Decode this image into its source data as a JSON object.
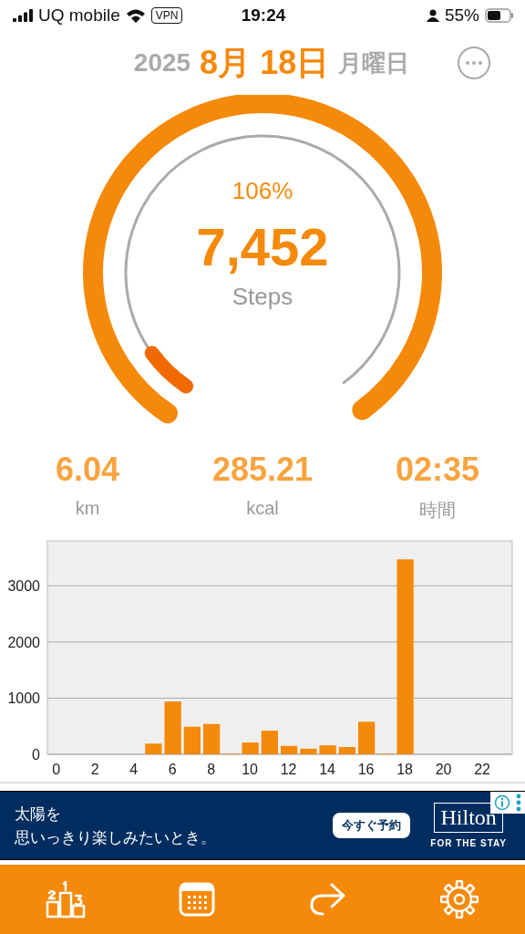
{
  "status_bar": {
    "carrier": "UQ mobile",
    "vpn": "VPN",
    "time": "19:24",
    "battery": "55%"
  },
  "date": {
    "year": "2025",
    "day": "8月 18日",
    "weekday": "月曜日"
  },
  "gauge": {
    "percent": "106%",
    "steps": "7,452",
    "unit": "Steps"
  },
  "stats": [
    {
      "value": "6.04",
      "label": "km"
    },
    {
      "value": "285.21",
      "label": "kcal"
    },
    {
      "value": "02:35",
      "label": "時間"
    }
  ],
  "chart_data": {
    "type": "bar",
    "x": [
      0,
      1,
      2,
      3,
      4,
      5,
      6,
      7,
      8,
      9,
      10,
      11,
      12,
      13,
      14,
      15,
      16,
      17,
      18,
      19,
      20,
      21,
      22,
      23
    ],
    "grid": true,
    "xlim": [
      -0.5,
      23.5
    ],
    "series": [
      {
        "color": "#f5890a",
        "values": [
          0,
          0,
          0,
          0,
          0,
          190,
          940,
          490,
          540,
          10,
          210,
          420,
          150,
          100,
          160,
          130,
          580,
          10,
          3470,
          0,
          0,
          0,
          0,
          0
        ]
      }
    ],
    "ylim": [
      0,
      3800
    ],
    "yticks": [
      0,
      1000,
      2000,
      3000
    ],
    "xticks": [
      0,
      2,
      4,
      6,
      8,
      10,
      12,
      14,
      16,
      18,
      20,
      22
    ]
  },
  "ad": {
    "headline_1": "太陽を",
    "headline_2": "思いっきり楽しみたいとき。",
    "cta": "今すぐ予約",
    "brand": "Hilton",
    "tagline": "FOR THE STAY"
  },
  "tab_bar": [
    {
      "kind": "ranking"
    },
    {
      "kind": "calendar"
    },
    {
      "kind": "share"
    },
    {
      "kind": "settings"
    }
  ]
}
